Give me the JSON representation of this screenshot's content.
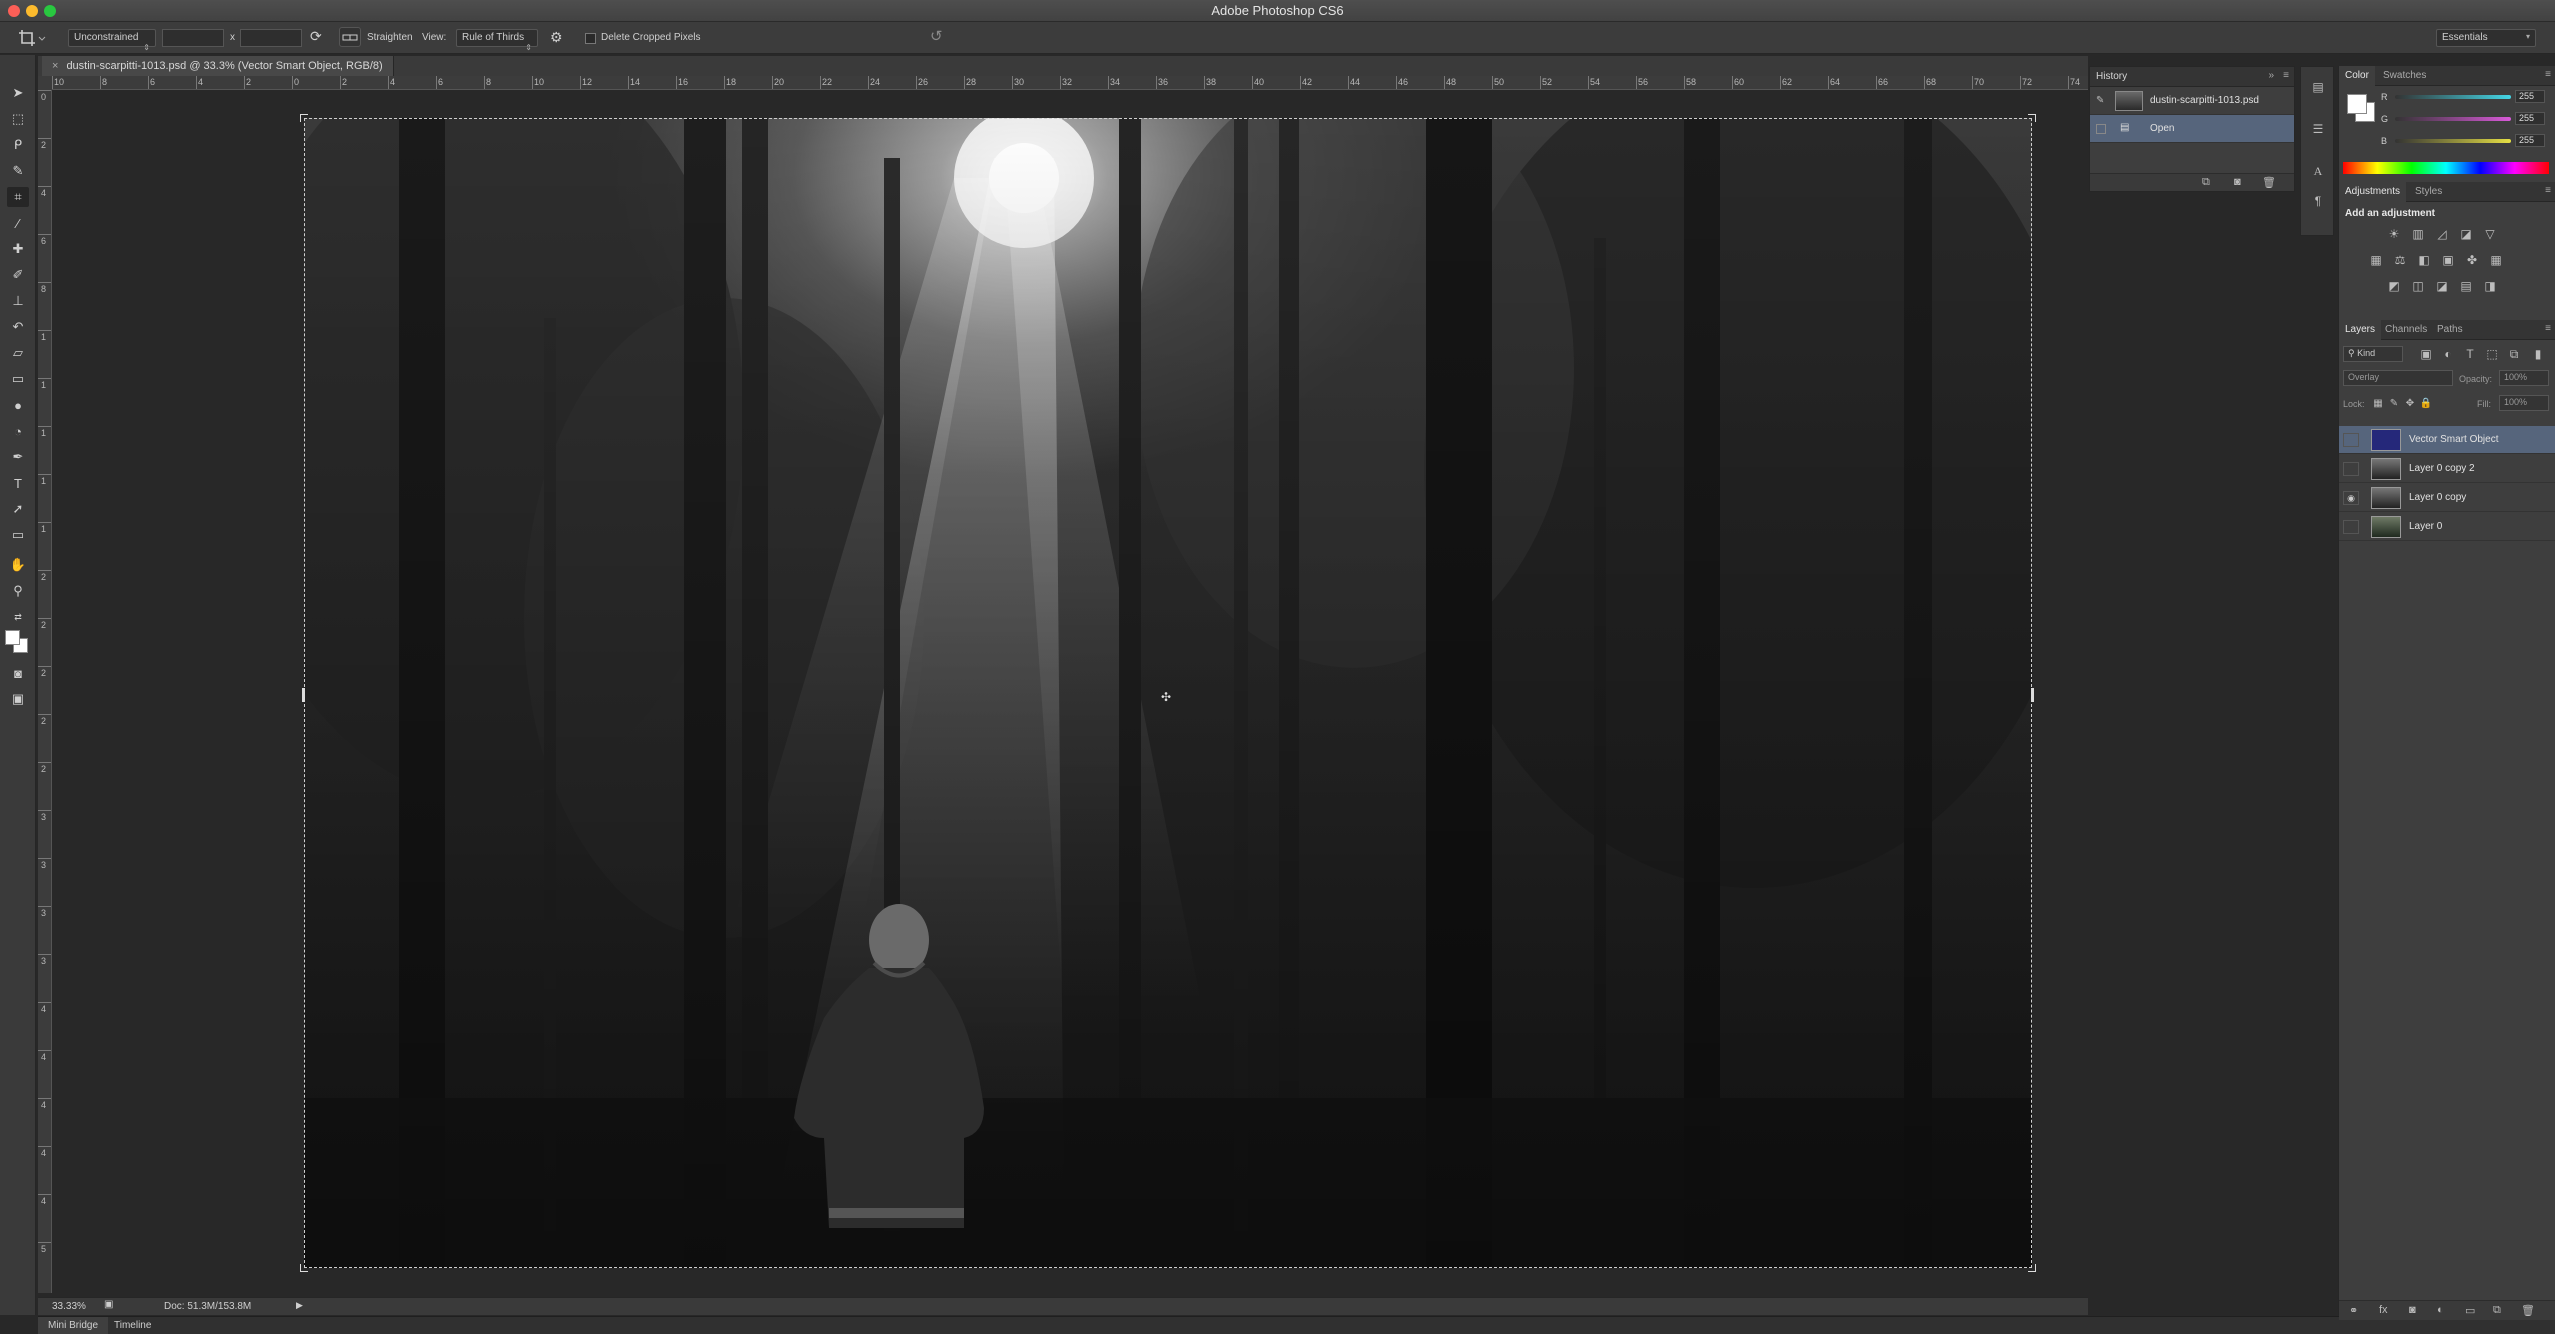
{
  "window": {
    "title": "Adobe Photoshop CS6"
  },
  "options_bar": {
    "ratio_preset": "Unconstrained",
    "ratio_separator": "x",
    "straighten_label": "Straighten",
    "view_label": "View:",
    "view_value": "Rule of Thirds",
    "delete_cropped_label": "Delete Cropped Pixels",
    "workspace": "Essentials"
  },
  "document": {
    "tab_title": "dustin-scarpitti-1013.psd @ 33.3% (Vector Smart Object, RGB/8)",
    "close_glyph": "×"
  },
  "rulers": {
    "horizontal": [
      "10",
      "8",
      "6",
      "4",
      "2",
      "0",
      "2",
      "4",
      "6",
      "8",
      "10",
      "12",
      "14",
      "16",
      "18",
      "20",
      "22",
      "24",
      "26",
      "28",
      "30",
      "32",
      "34",
      "36",
      "38",
      "40",
      "42",
      "44",
      "46",
      "48",
      "50",
      "52",
      "54",
      "56",
      "58",
      "60",
      "62",
      "64",
      "66",
      "68",
      "70",
      "72",
      "74"
    ],
    "vertical": [
      "0",
      "2",
      "4",
      "6",
      "8",
      "1",
      "1",
      "1",
      "1",
      "1",
      "2",
      "2",
      "2",
      "2",
      "2",
      "3",
      "3",
      "3",
      "3",
      "4",
      "4",
      "4",
      "4",
      "4",
      "5"
    ]
  },
  "status": {
    "zoom": "33.33%",
    "doc_size": "Doc: 51.3M/153.8M"
  },
  "bottom_tabs": [
    "Mini Bridge",
    "Timeline"
  ],
  "history": {
    "title": "History",
    "items": [
      {
        "label": "dustin-scarpitti-1013.psd",
        "selected": false
      },
      {
        "label": "Open",
        "selected": true
      }
    ]
  },
  "color_panel": {
    "tabs": [
      "Color",
      "Swatches"
    ],
    "channels": [
      {
        "label": "R",
        "value": "255",
        "color": "#44d6e6"
      },
      {
        "label": "G",
        "value": "255",
        "color": "#d95ad9"
      },
      {
        "label": "B",
        "value": "255",
        "color": "#e6e045"
      }
    ]
  },
  "adjustments_panel": {
    "tabs": [
      "Adjustments",
      "Styles"
    ],
    "heading": "Add an adjustment"
  },
  "layers_panel": {
    "tabs": [
      "Layers",
      "Channels",
      "Paths"
    ],
    "filter_kind": "Kind",
    "blend_mode": "Overlay",
    "opacity_label": "Opacity:",
    "opacity_value": "100%",
    "lock_label": "Lock:",
    "fill_label": "Fill:",
    "fill_value": "100%",
    "layers": [
      {
        "name": "Vector Smart Object",
        "visible": false,
        "selected": true
      },
      {
        "name": "Layer 0 copy 2",
        "visible": false,
        "selected": false
      },
      {
        "name": "Layer 0 copy",
        "visible": true,
        "selected": false
      },
      {
        "name": "Layer 0",
        "visible": false,
        "selected": false
      }
    ]
  },
  "colors": {
    "selection": "#56657c",
    "panel_bg": "#3e3e3e",
    "canvas_bg": "#282828"
  }
}
